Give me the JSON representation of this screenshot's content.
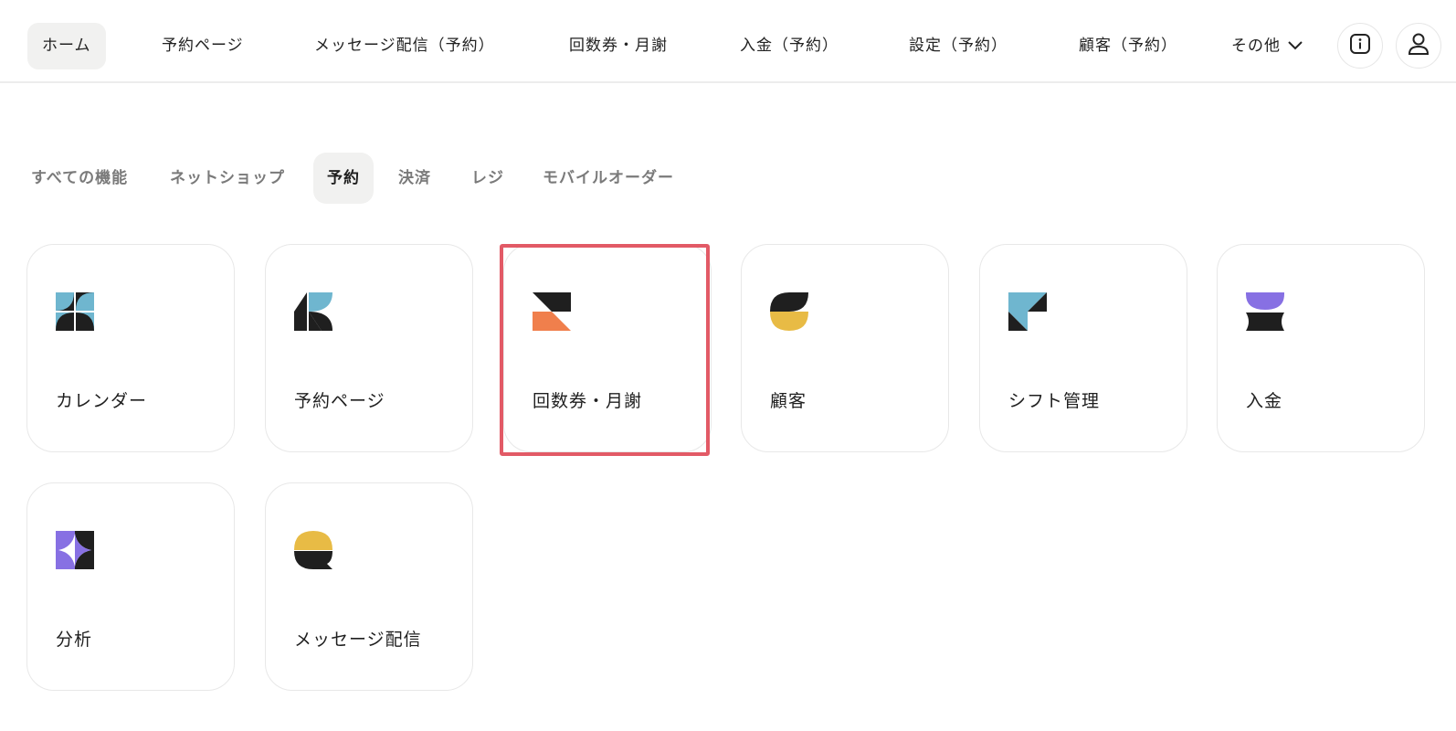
{
  "topnav": {
    "items": [
      {
        "label": "ホーム",
        "active": true
      },
      {
        "label": "予約ページ"
      },
      {
        "label": "メッセージ配信（予約）"
      },
      {
        "label": "回数券・月謝"
      },
      {
        "label": "入金（予約）"
      },
      {
        "label": "設定（予約）"
      },
      {
        "label": "顧客（予約）"
      }
    ],
    "more_label": "その他",
    "info_icon": "info-icon",
    "user_icon": "user-icon"
  },
  "filters": {
    "tabs": [
      {
        "label": "すべての機能"
      },
      {
        "label": "ネットショップ"
      },
      {
        "label": "予約",
        "active": true
      },
      {
        "label": "決済"
      },
      {
        "label": "レジ"
      },
      {
        "label": "モバイルオーダー"
      }
    ]
  },
  "cards": [
    {
      "label": "カレンダー",
      "icon": "calendar-icon"
    },
    {
      "label": "予約ページ",
      "icon": "booking-page-icon"
    },
    {
      "label": "回数券・月謝",
      "icon": "ticket-icon",
      "highlighted": true
    },
    {
      "label": "顧客",
      "icon": "customer-icon"
    },
    {
      "label": "シフト管理",
      "icon": "shift-icon"
    },
    {
      "label": "入金",
      "icon": "deposit-icon"
    },
    {
      "label": "分析",
      "icon": "analytics-icon"
    },
    {
      "label": "メッセージ配信",
      "icon": "message-icon"
    }
  ],
  "colors": {
    "blue": "#6fb6cf",
    "dark": "#1f1f1f",
    "orange": "#f07f4c",
    "yellow": "#e8bb45",
    "purple": "#8770e3",
    "highlight": "#e25a66"
  }
}
